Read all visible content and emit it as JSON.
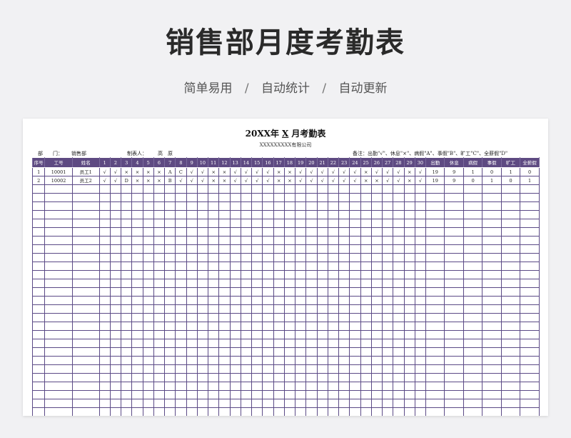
{
  "header": {
    "title": "销售部月度考勤表",
    "subtitle": [
      "简单易用",
      "自动统计",
      "自动更新"
    ],
    "separator": "/"
  },
  "sheet": {
    "title_prefix": "20XX年",
    "title_month": "X",
    "title_suffix": "月考勤表",
    "company": "XXXXXXXXX有限公司",
    "dept_label": "部　　门：",
    "dept_value": "销售部",
    "maker_label": "制表人：",
    "maker_value": "高　原",
    "note": "备注：出勤\"√\"、休息\"×\"、病假\"A\"、事假\"B\"、旷工\"C\"、全薪假\"D\"",
    "columns": {
      "seq": "序号",
      "id": "工号",
      "name": "姓名",
      "days": [
        "1",
        "2",
        "3",
        "4",
        "5",
        "6",
        "7",
        "8",
        "9",
        "10",
        "11",
        "12",
        "13",
        "14",
        "15",
        "16",
        "17",
        "18",
        "19",
        "20",
        "21",
        "22",
        "23",
        "24",
        "25",
        "26",
        "27",
        "28",
        "29",
        "30"
      ],
      "summary": [
        "出勤",
        "休息",
        "病假",
        "事假",
        "旷工",
        "全薪假"
      ]
    },
    "rows": [
      {
        "seq": "1",
        "id": "10001",
        "name": "员工1",
        "days": [
          "√",
          "√",
          "×",
          "×",
          "×",
          "×",
          "A",
          "C",
          "√",
          "√",
          "×",
          "×",
          "√",
          "√",
          "√",
          "√",
          "×",
          "×",
          "√",
          "√",
          "√",
          "√",
          "√",
          "√",
          "×",
          "√",
          "√",
          "√",
          "×",
          "√"
        ],
        "summary": [
          "19",
          "9",
          "1",
          "0",
          "1",
          "0"
        ]
      },
      {
        "seq": "2",
        "id": "10002",
        "name": "员工2",
        "days": [
          "√",
          "√",
          "D",
          "×",
          "×",
          "×",
          "B",
          "√",
          "√",
          "√",
          "×",
          "×",
          "√",
          "√",
          "√",
          "√",
          "×",
          "×",
          "√",
          "√",
          "√",
          "√",
          "√",
          "√",
          "×",
          "×",
          "√",
          "√",
          "×",
          "√"
        ],
        "summary": [
          "19",
          "9",
          "0",
          "1",
          "0",
          "1"
        ]
      }
    ],
    "empty_rows": 27
  },
  "colors": {
    "accent": "#5e4a82",
    "grid": "#5b4a86",
    "background": "#f1f1f3"
  }
}
